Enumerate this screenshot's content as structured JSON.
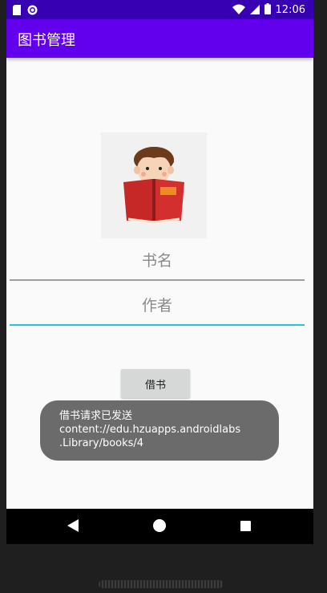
{
  "status_bar": {
    "time": "12:06",
    "icons": [
      "sd-card-icon",
      "circle-status-icon",
      "wifi-icon",
      "signal-icon",
      "battery-icon"
    ]
  },
  "app_bar": {
    "title": "图书管理"
  },
  "form": {
    "book_name_placeholder": "书名",
    "author_placeholder": "作者",
    "borrow_button_label": "借书"
  },
  "toast": {
    "line1": "借书请求已发送",
    "line2": "content://edu.hzuapps.androidlabs",
    "line3": ".Library/books/4"
  },
  "colors": {
    "status_bar": "#3700b3",
    "app_bar": "#6200ee",
    "focus_underline": "#26c6da"
  },
  "nav_bar": {
    "icons": [
      "back-icon",
      "home-icon",
      "recents-icon"
    ]
  }
}
